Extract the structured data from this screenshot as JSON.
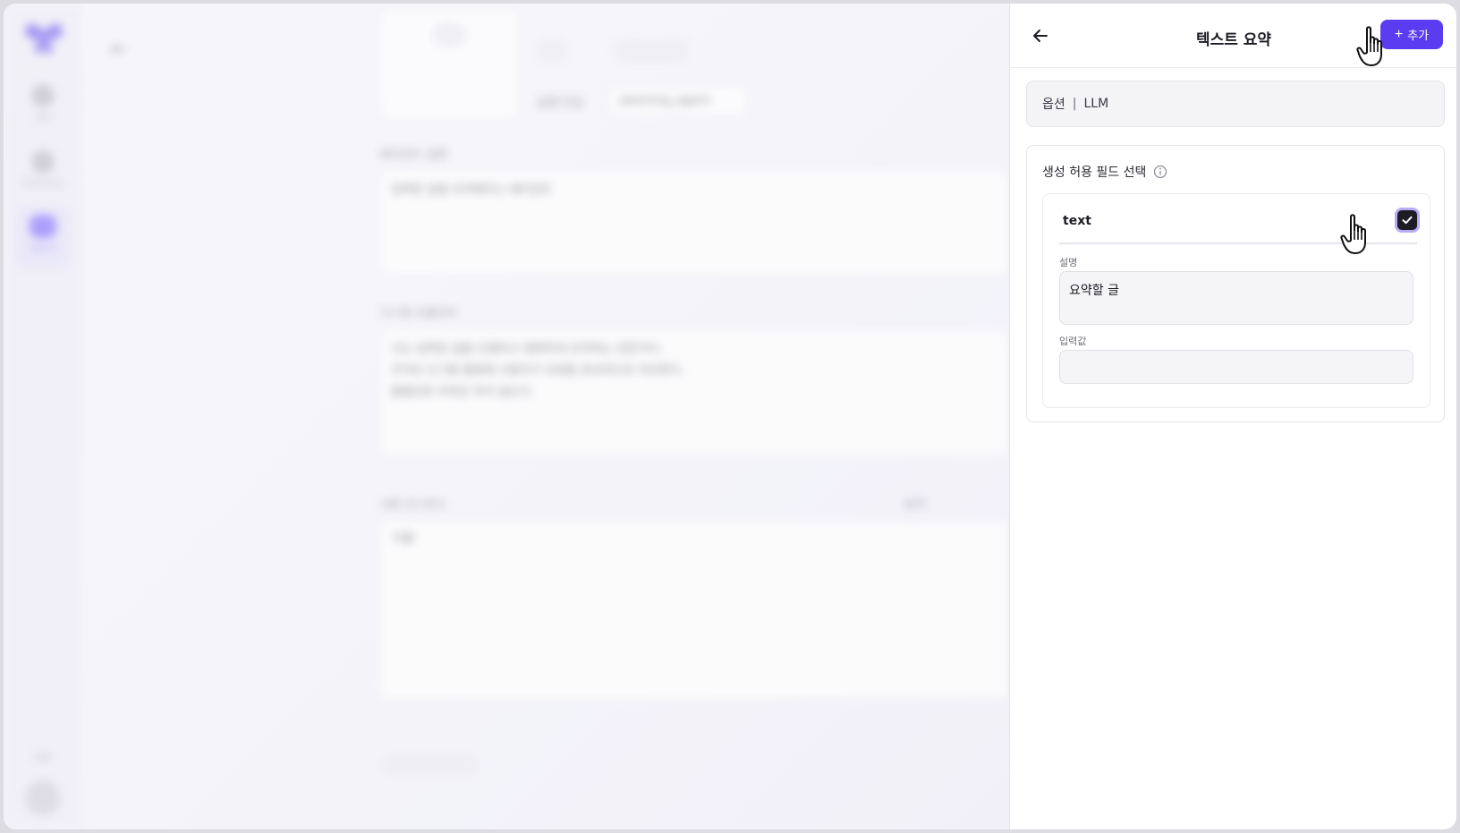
{
  "background": {
    "rail": {
      "items": [
        {
          "label": "Tool"
        },
        {
          "label": "Toolchain"
        },
        {
          "label": "Agent"
        }
      ]
    },
    "model_label": "실행 타입",
    "model_value": "planning_agent",
    "description_label": "에이전트 설명",
    "description_value": "입력된 글을 요약해주는 에이전트",
    "prompt_label": "시스템 프롬프트",
    "prompt_lines": [
      "너는 입력된 글을 간결하고 명확하게 요약하는 전문가다.",
      "주어진 도구를 활용해 사용자가 요청을 효과적으로 처리한다.",
      "불필요한 추측은 하지 않는다."
    ],
    "tools_label": "사용 인스턴스",
    "search_placeholder": "검색",
    "table_header": "이름"
  },
  "panel": {
    "title": "텍스트 요약",
    "add_label": "추가",
    "option_prefix": "옵션",
    "option_separator": "|",
    "option_value": "LLM",
    "field_section_title": "생성 허용 필드 선택",
    "field": {
      "name": "text",
      "checked": true,
      "description_label": "설명",
      "description_value": "요약할 글",
      "input_label": "입력값",
      "input_value": ""
    }
  },
  "colors": {
    "accent": "#5b3cf0",
    "checkbox": "#1d1c24"
  }
}
